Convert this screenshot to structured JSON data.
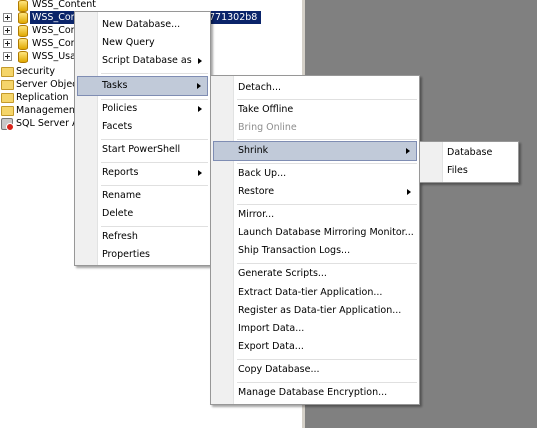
{
  "tree": {
    "nodes": [
      "WSS_Content",
      "WSS_Content_",
      "WSS_Conte",
      "WSS_Conte",
      "WSS_Usag",
      "Security",
      "Server Objects",
      "Replication",
      "Management",
      "SQL Server Ag"
    ],
    "selected_suffix": "771302b8"
  },
  "context_menu": {
    "items": [
      "New Database...",
      "New Query",
      "Script Database as",
      "Tasks",
      "Policies",
      "Facets",
      "Start PowerShell",
      "Reports",
      "Rename",
      "Delete",
      "Refresh",
      "Properties"
    ]
  },
  "tasks_menu": {
    "items": [
      "Detach...",
      "Take Offline",
      "Bring Online",
      "Shrink",
      "Back Up...",
      "Restore",
      "Mirror...",
      "Launch Database Mirroring Monitor...",
      "Ship Transaction Logs...",
      "Generate Scripts...",
      "Extract Data-tier Application...",
      "Register as Data-tier Application...",
      "Import Data...",
      "Export Data...",
      "Copy Database...",
      "Manage Database Encryption..."
    ]
  },
  "shrink_menu": {
    "items": [
      "Database",
      "Files"
    ]
  }
}
